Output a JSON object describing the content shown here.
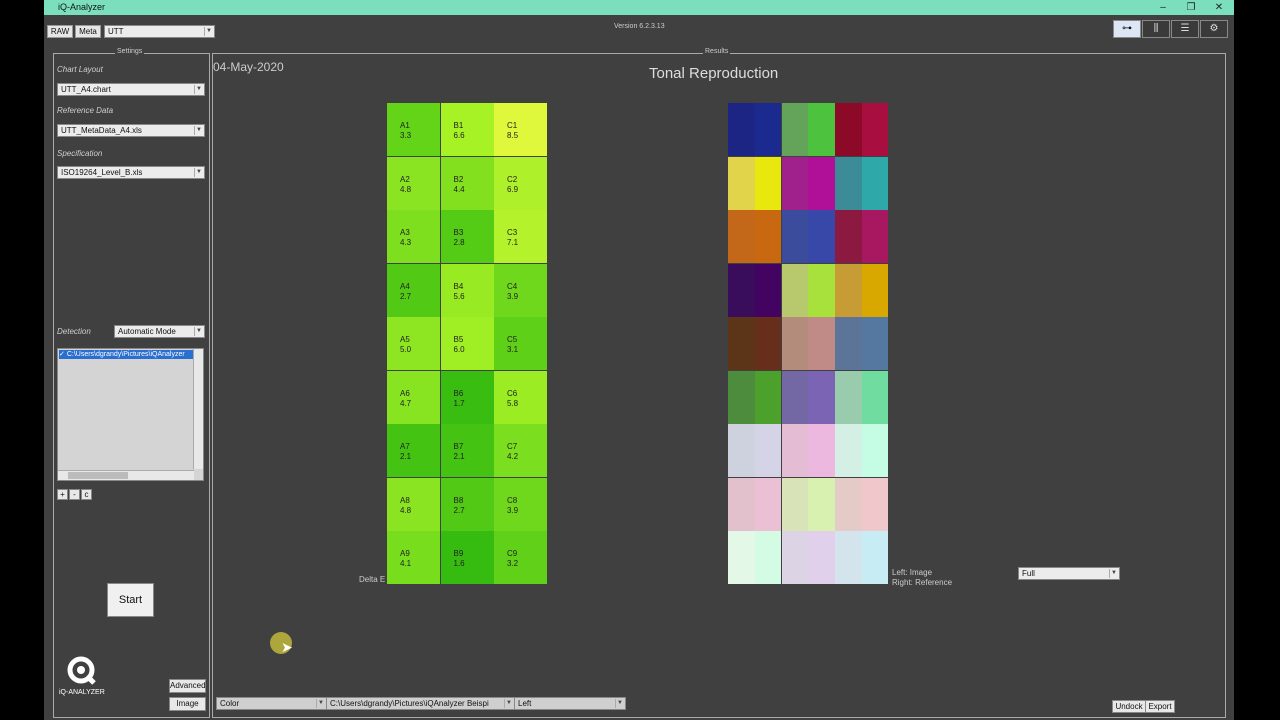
{
  "app": {
    "title": "iQ-Analyzer",
    "version": "Version 6.2.3.13"
  },
  "toolbar": {
    "raw": "RAW",
    "meta": "Meta",
    "utt": "UTT"
  },
  "settings": {
    "legend": "Settings",
    "chart_layout_label": "Chart Layout",
    "chart_layout_value": "UTT_A4.chart",
    "reference_label": "Reference Data",
    "reference_value": "UTT_MetaData_A4.xls",
    "spec_label": "Specification",
    "spec_value": "ISO19264_Level_B.xls",
    "detection_label": "Detection",
    "detection_value": "Automatic Mode",
    "file_path": "C:\\Users\\dgrandy\\Pictures\\iQAnalyzer",
    "add": "+",
    "remove": "-",
    "clear": "c",
    "start": "Start",
    "advanced": "Advanced",
    "image": "Image",
    "logo_text": "iQ-ANALYZER"
  },
  "results": {
    "legend": "Results",
    "date": "04-May-2020",
    "title": "Tonal Reproduction",
    "delta_label": "Delta E",
    "grid": [
      [
        {
          "id": "A1",
          "v": "3.3",
          "c": "#63d418"
        },
        {
          "id": "B1",
          "v": "6.6",
          "c": "#a6f225"
        },
        {
          "id": "C1",
          "v": "8.5",
          "c": "#dff83b"
        }
      ],
      [
        {
          "id": "A2",
          "v": "4.8",
          "c": "#8ae421"
        },
        {
          "id": "B2",
          "v": "4.4",
          "c": "#82e01f"
        },
        {
          "id": "C2",
          "v": "6.9",
          "c": "#aef12a"
        }
      ],
      [
        {
          "id": "A3",
          "v": "4.3",
          "c": "#7ddf1e"
        },
        {
          "id": "B3",
          "v": "2.8",
          "c": "#54cb15"
        },
        {
          "id": "C3",
          "v": "7.1",
          "c": "#b4f22c"
        }
      ],
      [
        {
          "id": "A4",
          "v": "2.7",
          "c": "#52c914"
        },
        {
          "id": "B4",
          "v": "5.6",
          "c": "#98ea23"
        },
        {
          "id": "C4",
          "v": "3.9",
          "c": "#70d81c"
        }
      ],
      [
        {
          "id": "A5",
          "v": "5.0",
          "c": "#8ee521"
        },
        {
          "id": "B5",
          "v": "6.0",
          "c": "#a0ee24"
        },
        {
          "id": "C5",
          "v": "3.1",
          "c": "#5ed017"
        }
      ],
      [
        {
          "id": "A6",
          "v": "4.7",
          "c": "#88e321"
        },
        {
          "id": "B6",
          "v": "1.7",
          "c": "#38bd10"
        },
        {
          "id": "C6",
          "v": "5.8",
          "c": "#9bec23"
        }
      ],
      [
        {
          "id": "A7",
          "v": "2.1",
          "c": "#44c312"
        },
        {
          "id": "B7",
          "v": "2.1",
          "c": "#44c312"
        },
        {
          "id": "C7",
          "v": "4.2",
          "c": "#7bde1e"
        }
      ],
      [
        {
          "id": "A8",
          "v": "4.8",
          "c": "#8ae421"
        },
        {
          "id": "B8",
          "v": "2.7",
          "c": "#52c914"
        },
        {
          "id": "C8",
          "v": "3.9",
          "c": "#70d81c"
        }
      ],
      [
        {
          "id": "A9",
          "v": "4.1",
          "c": "#78dd1d"
        },
        {
          "id": "B9",
          "v": "1.6",
          "c": "#36bc10"
        },
        {
          "id": "C9",
          "v": "3.2",
          "c": "#60d118"
        }
      ]
    ],
    "swatches": [
      [
        [
          "#1c2484",
          "#1a2a8e"
        ],
        [
          "#63a45a",
          "#4cc23f"
        ],
        [
          "#8c0a28",
          "#a80e3f"
        ]
      ],
      [
        [
          "#e2d44a",
          "#e8e80e"
        ],
        [
          "#a0208c",
          "#b01098"
        ],
        [
          "#3c8c98",
          "#2ea8a8"
        ]
      ],
      [
        [
          "#c26818",
          "#c86810"
        ],
        [
          "#3c4c9c",
          "#3848a8"
        ],
        [
          "#8c1a40",
          "#a81860"
        ]
      ],
      [
        [
          "#3a0c5c",
          "#420460"
        ],
        [
          "#b8c86c",
          "#a8e03c"
        ],
        [
          "#c89c34",
          "#d8a800"
        ]
      ],
      [
        [
          "#5c3418",
          "#682e1c"
        ],
        [
          "#b48c7c",
          "#c08a86"
        ],
        [
          "#5c7498",
          "#5478a0"
        ]
      ],
      [
        [
          "#4c8c3c",
          "#4ca02c"
        ],
        [
          "#7468a4",
          "#7c64b4"
        ],
        [
          "#98ccac",
          "#70dca0"
        ]
      ],
      [
        [
          "#ced2de",
          "#d4d4e6"
        ],
        [
          "#e4bcd4",
          "#ecb8e0"
        ],
        [
          "#d4f0e4",
          "#c4fce4"
        ]
      ],
      [
        [
          "#e2c0cc",
          "#ecc0d4"
        ],
        [
          "#d8e4b8",
          "#d8f0b0"
        ],
        [
          "#e4cbc8",
          "#f0c8cc"
        ]
      ],
      [
        [
          "#e4f8e8",
          "#d4fce4"
        ],
        [
          "#dcd4e4",
          "#e0d0ec"
        ],
        [
          "#d4e4ec",
          "#c8ecf4"
        ]
      ]
    ],
    "side_left": "Left:    Image",
    "side_right": "Right: Reference",
    "full": "Full",
    "bottom_color": "Color",
    "bottom_path": "C:\\Users\\dgrandy\\Pictures\\iQAnalyzer Beispi",
    "bottom_left": "Left",
    "undock": "Undock",
    "export": "Export"
  }
}
